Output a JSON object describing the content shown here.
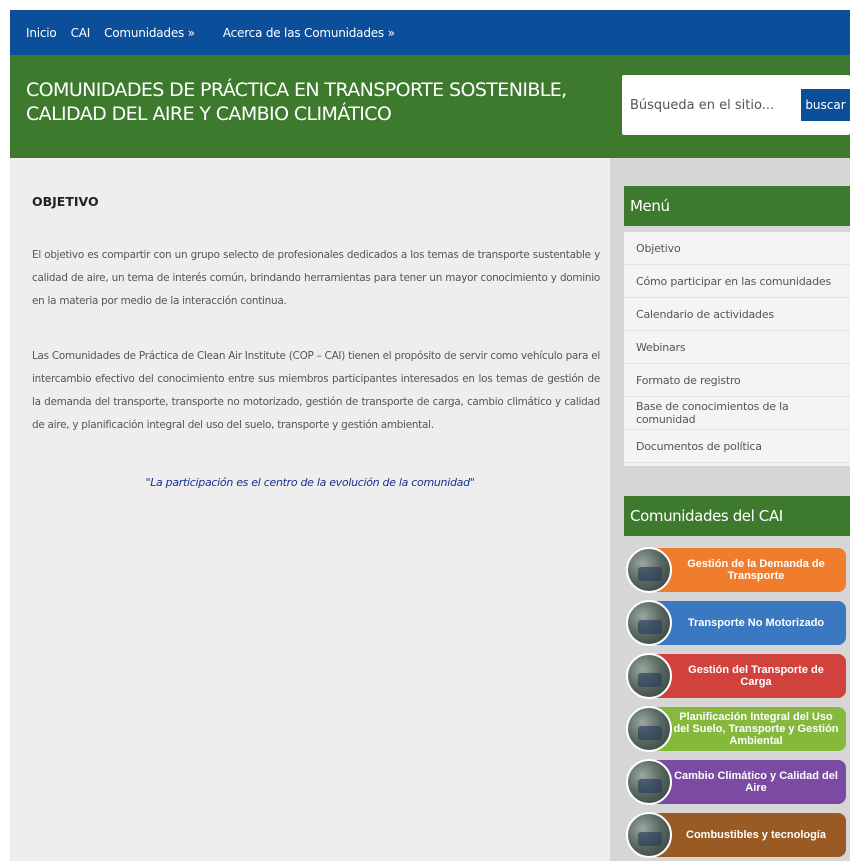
{
  "nav": {
    "items": [
      "Inicio",
      "CAI",
      "Comunidades »",
      "Acerca de las Comunidades »"
    ]
  },
  "header": {
    "title": "COMUNIDADES DE PRÁCTICA EN TRANSPORTE SOSTENIBLE, CALIDAD DEL AIRE Y CAMBIO CLIMÁTICO"
  },
  "search": {
    "placeholder": "Búsqueda en el sitio...",
    "button": "buscar"
  },
  "main": {
    "heading": "OBJETIVO",
    "paragraph1": "El objetivo es compartir con un grupo selecto de profesionales dedicados a los temas de transporte sustentable y calidad de aire, un tema de interés común, brindando herramientas para tener un mayor conocimiento y dominio en la materia por medio de la interacción continua.",
    "paragraph2": "Las Comunidades de Práctica de Clean Air Institute (COP – CAI) tienen el propósito de servir como vehículo para el intercambio efectivo del conocimiento entre sus miembros participantes interesados en los temas de gestión de la demanda del transporte, transporte no motorizado, gestión de transporte de carga, cambio climático y calidad de aire, y planificación integral del uso del suelo, transporte y gestión ambiental.",
    "quote": "\"La participación es el centro de la evolución de la comunidad\""
  },
  "sidebar": {
    "menu_title": "Menú",
    "menu_items": [
      "Objetivo",
      "Cómo participar en las comunidades",
      "Calendario de actividades",
      "Webinars",
      "Formato de registro",
      "Base de conocimientos de la comunidad",
      "Documentos de política"
    ],
    "communities_title": "Comunidades del CAI",
    "communities": [
      {
        "label": "Gestión de la Demanda de Transporte",
        "color": "#f07d2e"
      },
      {
        "label": "Transporte No Motorizado",
        "color": "#3a78c2"
      },
      {
        "label": "Gestión del Transporte de Carga",
        "color": "#d2423d"
      },
      {
        "label": "Planificación Integral del Uso del Suelo, Transporte y Gestión Ambiental",
        "color": "#86b83c"
      },
      {
        "label": "Cambio Climático y Calidad del Aire",
        "color": "#7b4aa3"
      },
      {
        "label": "Combustibles y tecnología",
        "color": "#9a5a24"
      }
    ]
  },
  "colors": {
    "nav_bg": "#0b4f9a",
    "header_bg": "#3e7a2d",
    "quote_text": "#1a2f8f"
  }
}
